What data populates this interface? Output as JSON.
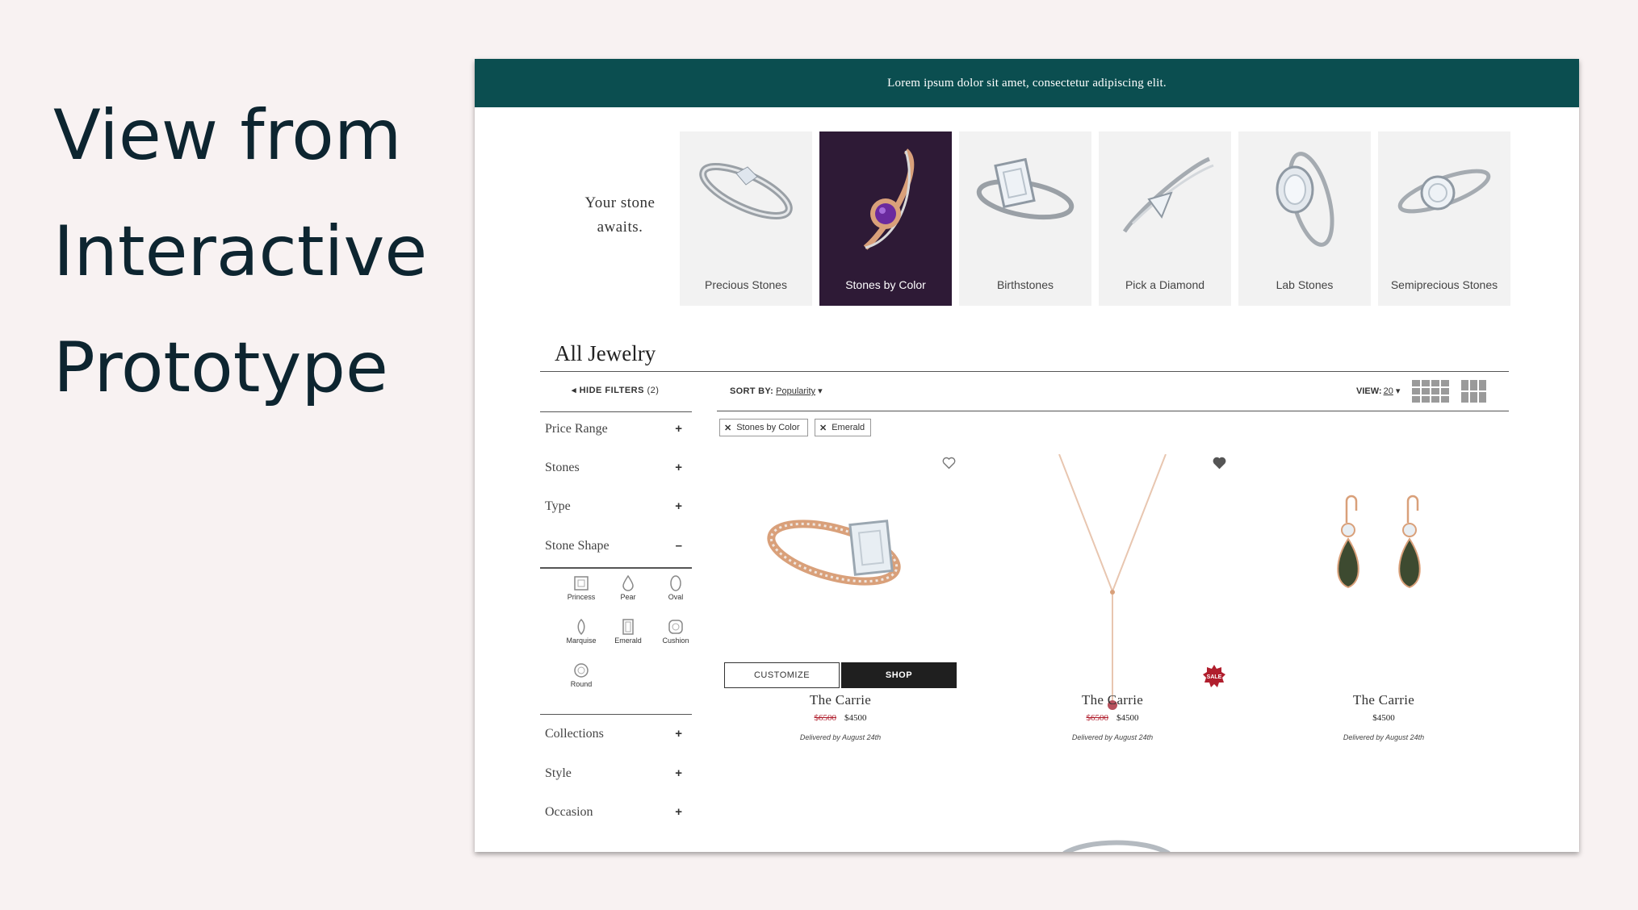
{
  "headline": [
    "View from",
    "Interactive",
    "Prototype"
  ],
  "banner": {
    "text": "Lorem ipsum dolor sit amet, consectetur adipiscing elit."
  },
  "tagline": {
    "line1": "Your stone",
    "line2": "awaits."
  },
  "categories": [
    {
      "label": "Precious Stones",
      "icon": "ring-icon"
    },
    {
      "label": "Stones by Color",
      "icon": "ring-icon",
      "active": true
    },
    {
      "label": "Birthstones",
      "icon": "ring-icon"
    },
    {
      "label": "Pick a Diamond",
      "icon": "ring-icon"
    },
    {
      "label": "Lab Stones",
      "icon": "ring-icon"
    },
    {
      "label": "Semiprecious Stones",
      "icon": "ring-icon"
    }
  ],
  "page_title": "All Jewelry",
  "toolbar": {
    "hide_filters": "HIDE FILTERS",
    "filter_count": "(2)",
    "sort_label": "SORT BY:",
    "sort_value": "Popularity",
    "view_label": "VIEW:",
    "view_value": "20"
  },
  "filters": {
    "price_range": {
      "label": "Price Range",
      "toggle": "+"
    },
    "stones": {
      "label": "Stones",
      "toggle": "+"
    },
    "type": {
      "label": "Type",
      "toggle": "+"
    },
    "stone_shape": {
      "label": "Stone Shape",
      "toggle": "–"
    },
    "collections": {
      "label": "Collections",
      "toggle": "+"
    },
    "style": {
      "label": "Style",
      "toggle": "+"
    },
    "occasion": {
      "label": "Occasion",
      "toggle": "+"
    }
  },
  "shapes": [
    "Princess",
    "Pear",
    "Oval",
    "Marquise",
    "Emerald",
    "Cushion",
    "Round"
  ],
  "active_filters": [
    {
      "label": "Stones by Color",
      "remove": "✕"
    },
    {
      "label": "Emerald",
      "remove": "✕"
    }
  ],
  "buttons": {
    "customize": "CUSTOMIZE",
    "shop": "SHOP"
  },
  "sale_badge": "SALE",
  "products": [
    {
      "name": "The Carrie",
      "old_price": "$6500",
      "price": "$4500",
      "delivery": "Delivered by August 24th"
    },
    {
      "name": "The Carrie",
      "old_price": "$6500",
      "price": "$4500",
      "delivery": "Delivered by August 24th"
    },
    {
      "name": "The Carrie",
      "price": "$4500",
      "delivery": "Delivered by August 24th"
    }
  ],
  "colors": {
    "banner": "#0b4e50",
    "active_category": "#2e1a36",
    "sale": "#b01e2d"
  }
}
